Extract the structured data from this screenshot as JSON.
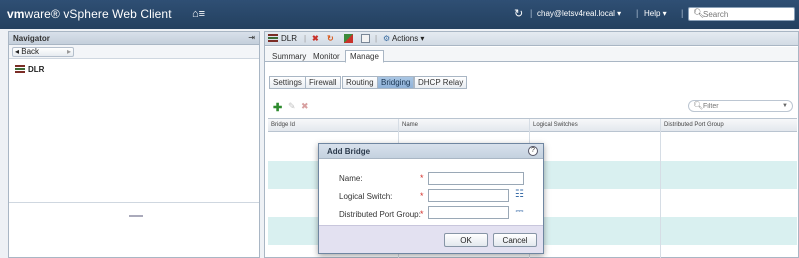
{
  "header": {
    "brand_vm": "vm",
    "brand_ware": "ware® vSphere Web Client",
    "home_icon": "⌂≡",
    "refresh_icon": "↻",
    "separator": "|",
    "user_menu": "chay@letsv4real.local ▾",
    "help_menu": "Help ▾",
    "search_placeholder": "Search"
  },
  "navigator": {
    "title": "Navigator",
    "pin_icon": "⇥",
    "back_label": "◂ Back",
    "forward_icon": "▸",
    "tree_item": "DLR"
  },
  "toolbar": {
    "object_label": "DLR",
    "actions_label": "Actions ▾"
  },
  "tabs": {
    "summary": "Summary",
    "monitor": "Monitor",
    "manage": "Manage"
  },
  "subtabs": [
    "Settings",
    "Firewall",
    "Routing",
    "Bridging",
    "DHCP Relay"
  ],
  "grid": {
    "filter_placeholder": "Filter",
    "columns": [
      "Bridge Id",
      "Name",
      "Logical Switches",
      "Distributed Port Group"
    ]
  },
  "dialog": {
    "title": "Add Bridge",
    "help_glyph": "?",
    "name_label": "Name:",
    "logical_switch_label": "Logical Switch:",
    "port_group_label": "Distributed Port Group:",
    "required_mark": "*",
    "ok_label": "OK",
    "cancel_label": "Cancel"
  },
  "colors": {
    "header_bg": "#2f4f74",
    "selected_subtab": "#8fb2d8",
    "alt_row": "#d9f0f0",
    "required": "#d3312b",
    "add_green": "#2e8b2e"
  }
}
